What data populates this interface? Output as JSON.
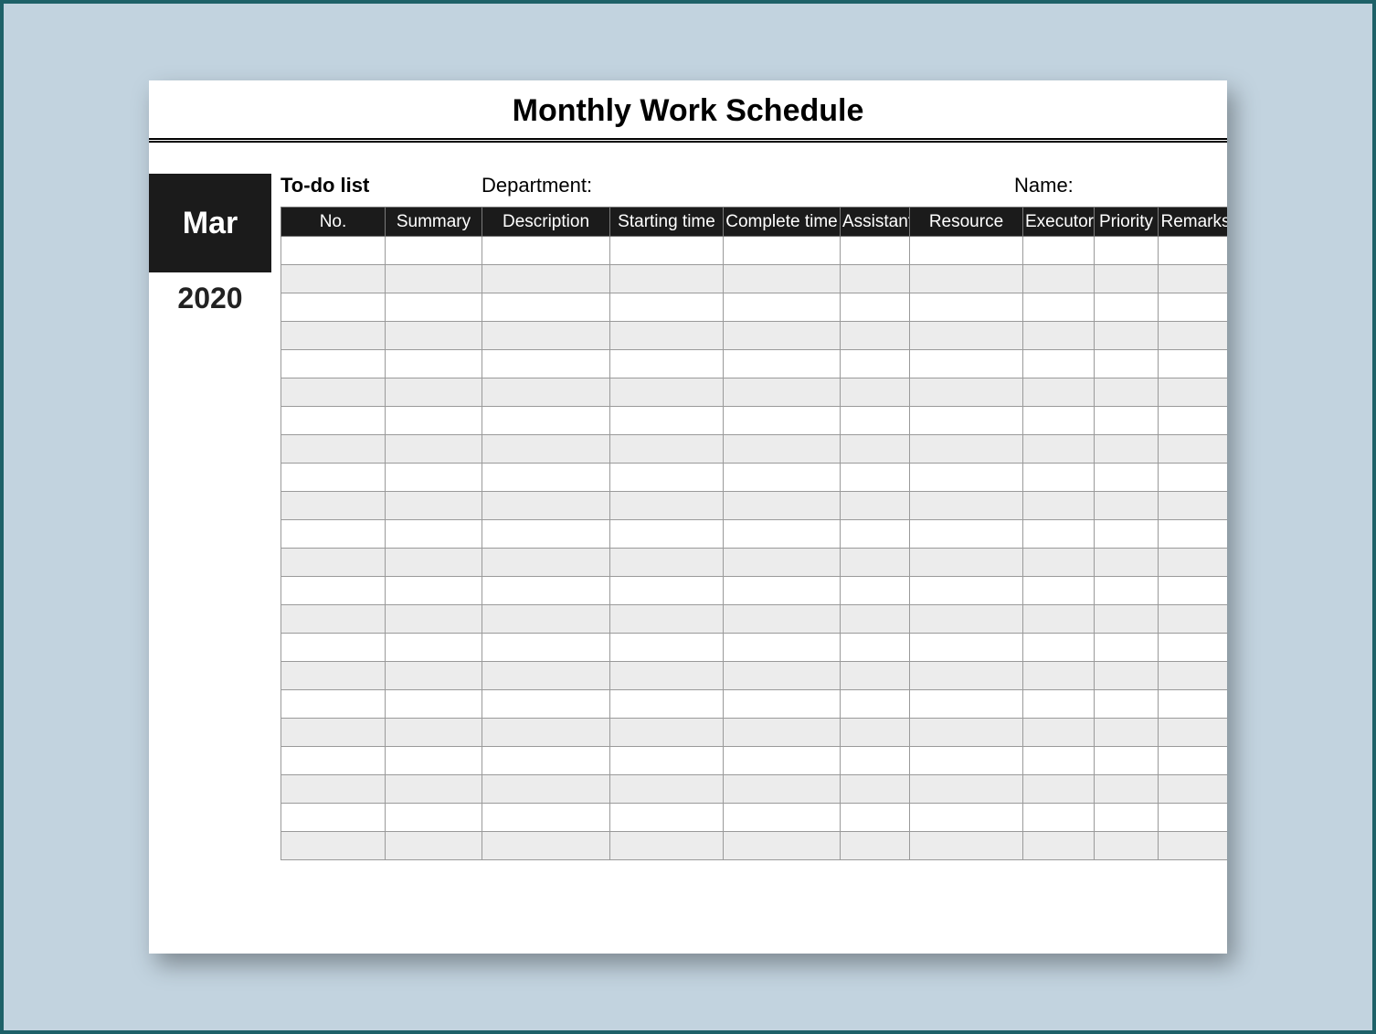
{
  "title": "Monthly Work Schedule",
  "month": "Mar",
  "year": "2020",
  "labels": {
    "todo": "To-do list",
    "department": "Department:",
    "name": "Name:"
  },
  "columns": [
    "No.",
    "Summary",
    "Description",
    "Starting time",
    "Complete time",
    "Assistant",
    "Resource",
    "Executor",
    "Priority",
    "Remarks"
  ],
  "row_count": 22
}
